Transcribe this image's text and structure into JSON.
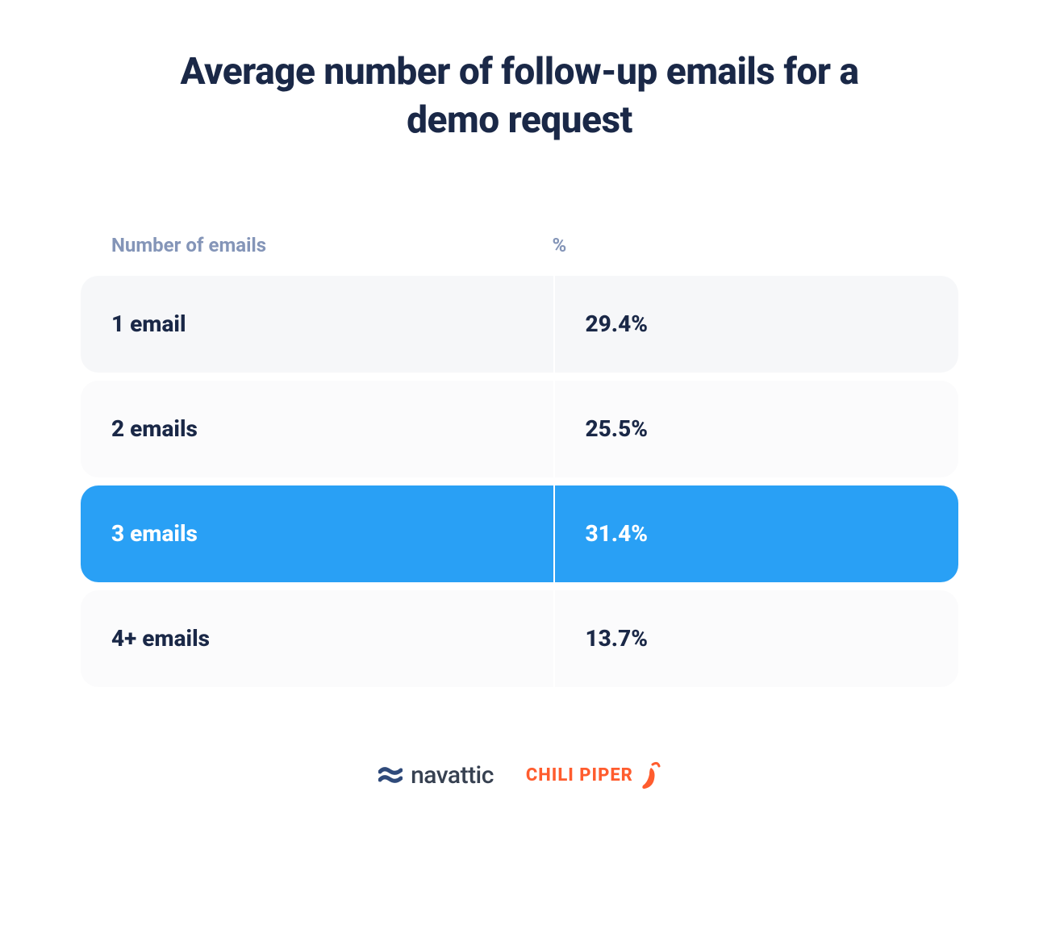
{
  "title": "Average number of follow-up emails for a demo request",
  "headers": {
    "left": "Number of emails",
    "right": "%"
  },
  "rows": [
    {
      "label": "1 email",
      "value": "29.4%",
      "shade": "row-shade-1",
      "highlight": false
    },
    {
      "label": "2 emails",
      "value": "25.5%",
      "shade": "row-shade-2",
      "highlight": false
    },
    {
      "label": "3 emails",
      "value": "31.4%",
      "shade": "row-highlight",
      "highlight": true
    },
    {
      "label": "4+ emails",
      "value": "13.7%",
      "shade": "row-shade-2",
      "highlight": false
    }
  ],
  "logos": {
    "navattic": "navattic",
    "chilipiper": "CHILI PIPER"
  },
  "colors": {
    "title": "#1a2847",
    "header_text": "#8495b8",
    "highlight_bg": "#29a0f5",
    "shade1": "#f6f7f9",
    "shade2": "#fbfbfc",
    "chili_orange": "#ff5c2e"
  },
  "chart_data": {
    "type": "table",
    "title": "Average number of follow-up emails for a demo request",
    "columns": [
      "Number of emails",
      "%"
    ],
    "categories": [
      "1 email",
      "2 emails",
      "3 emails",
      "4+ emails"
    ],
    "values": [
      29.4,
      25.5,
      31.4,
      13.7
    ],
    "highlight_index": 2,
    "xlabel": "Number of emails",
    "ylabel": "%"
  }
}
